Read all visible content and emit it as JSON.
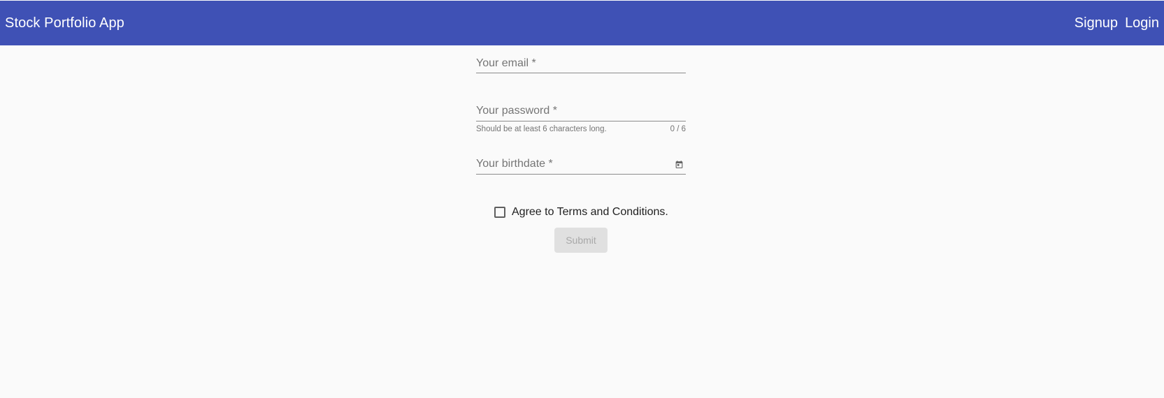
{
  "header": {
    "title": "Stock Portfolio App",
    "nav": {
      "signup": "Signup",
      "login": "Login"
    },
    "background_color": "#3f51b5"
  },
  "form": {
    "email": {
      "placeholder": "Your email *",
      "value": ""
    },
    "password": {
      "placeholder": "Your password *",
      "value": "",
      "hint": "Should be at least 6 characters long.",
      "counter": "0 / 6"
    },
    "birthdate": {
      "placeholder": "Your birthdate *",
      "value": "",
      "icon": "calendar-icon"
    },
    "terms": {
      "label": "Agree to Terms and Conditions.",
      "checked": false
    },
    "submit": {
      "label": "Submit",
      "disabled": true
    }
  }
}
